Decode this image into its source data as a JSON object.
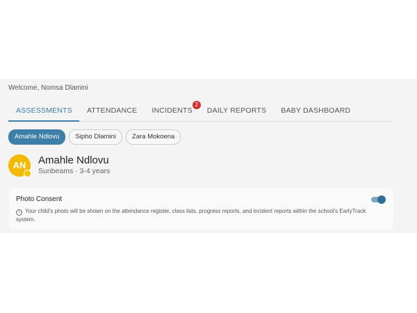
{
  "welcome": "Welcome, Nomsa Dlamini",
  "tabs": [
    {
      "label": "ASSESSMENTS"
    },
    {
      "label": "ATTENDANCE"
    },
    {
      "label": "INCIDENTS",
      "badge": "2"
    },
    {
      "label": "DAILY REPORTS"
    },
    {
      "label": "BABY DASHBOARD"
    }
  ],
  "children": [
    "Amahle Ndlovu",
    "Sipho Dlamini",
    "Zara Mokoena"
  ],
  "profile": {
    "initials": "AN",
    "name": "Amahle Ndlovu",
    "subtitle": "Sunbeams · 3-4 years"
  },
  "consent": {
    "title": "Photo Consent",
    "description": "Your child's photo will be shown on the attendance register, class lists, progress reports, and incident reports within the school's EarlyTrack system.",
    "enabled": true
  },
  "colors": {
    "accent": "#3d7fa6",
    "badge": "#d32f2f",
    "avatar": "#f5b800"
  }
}
